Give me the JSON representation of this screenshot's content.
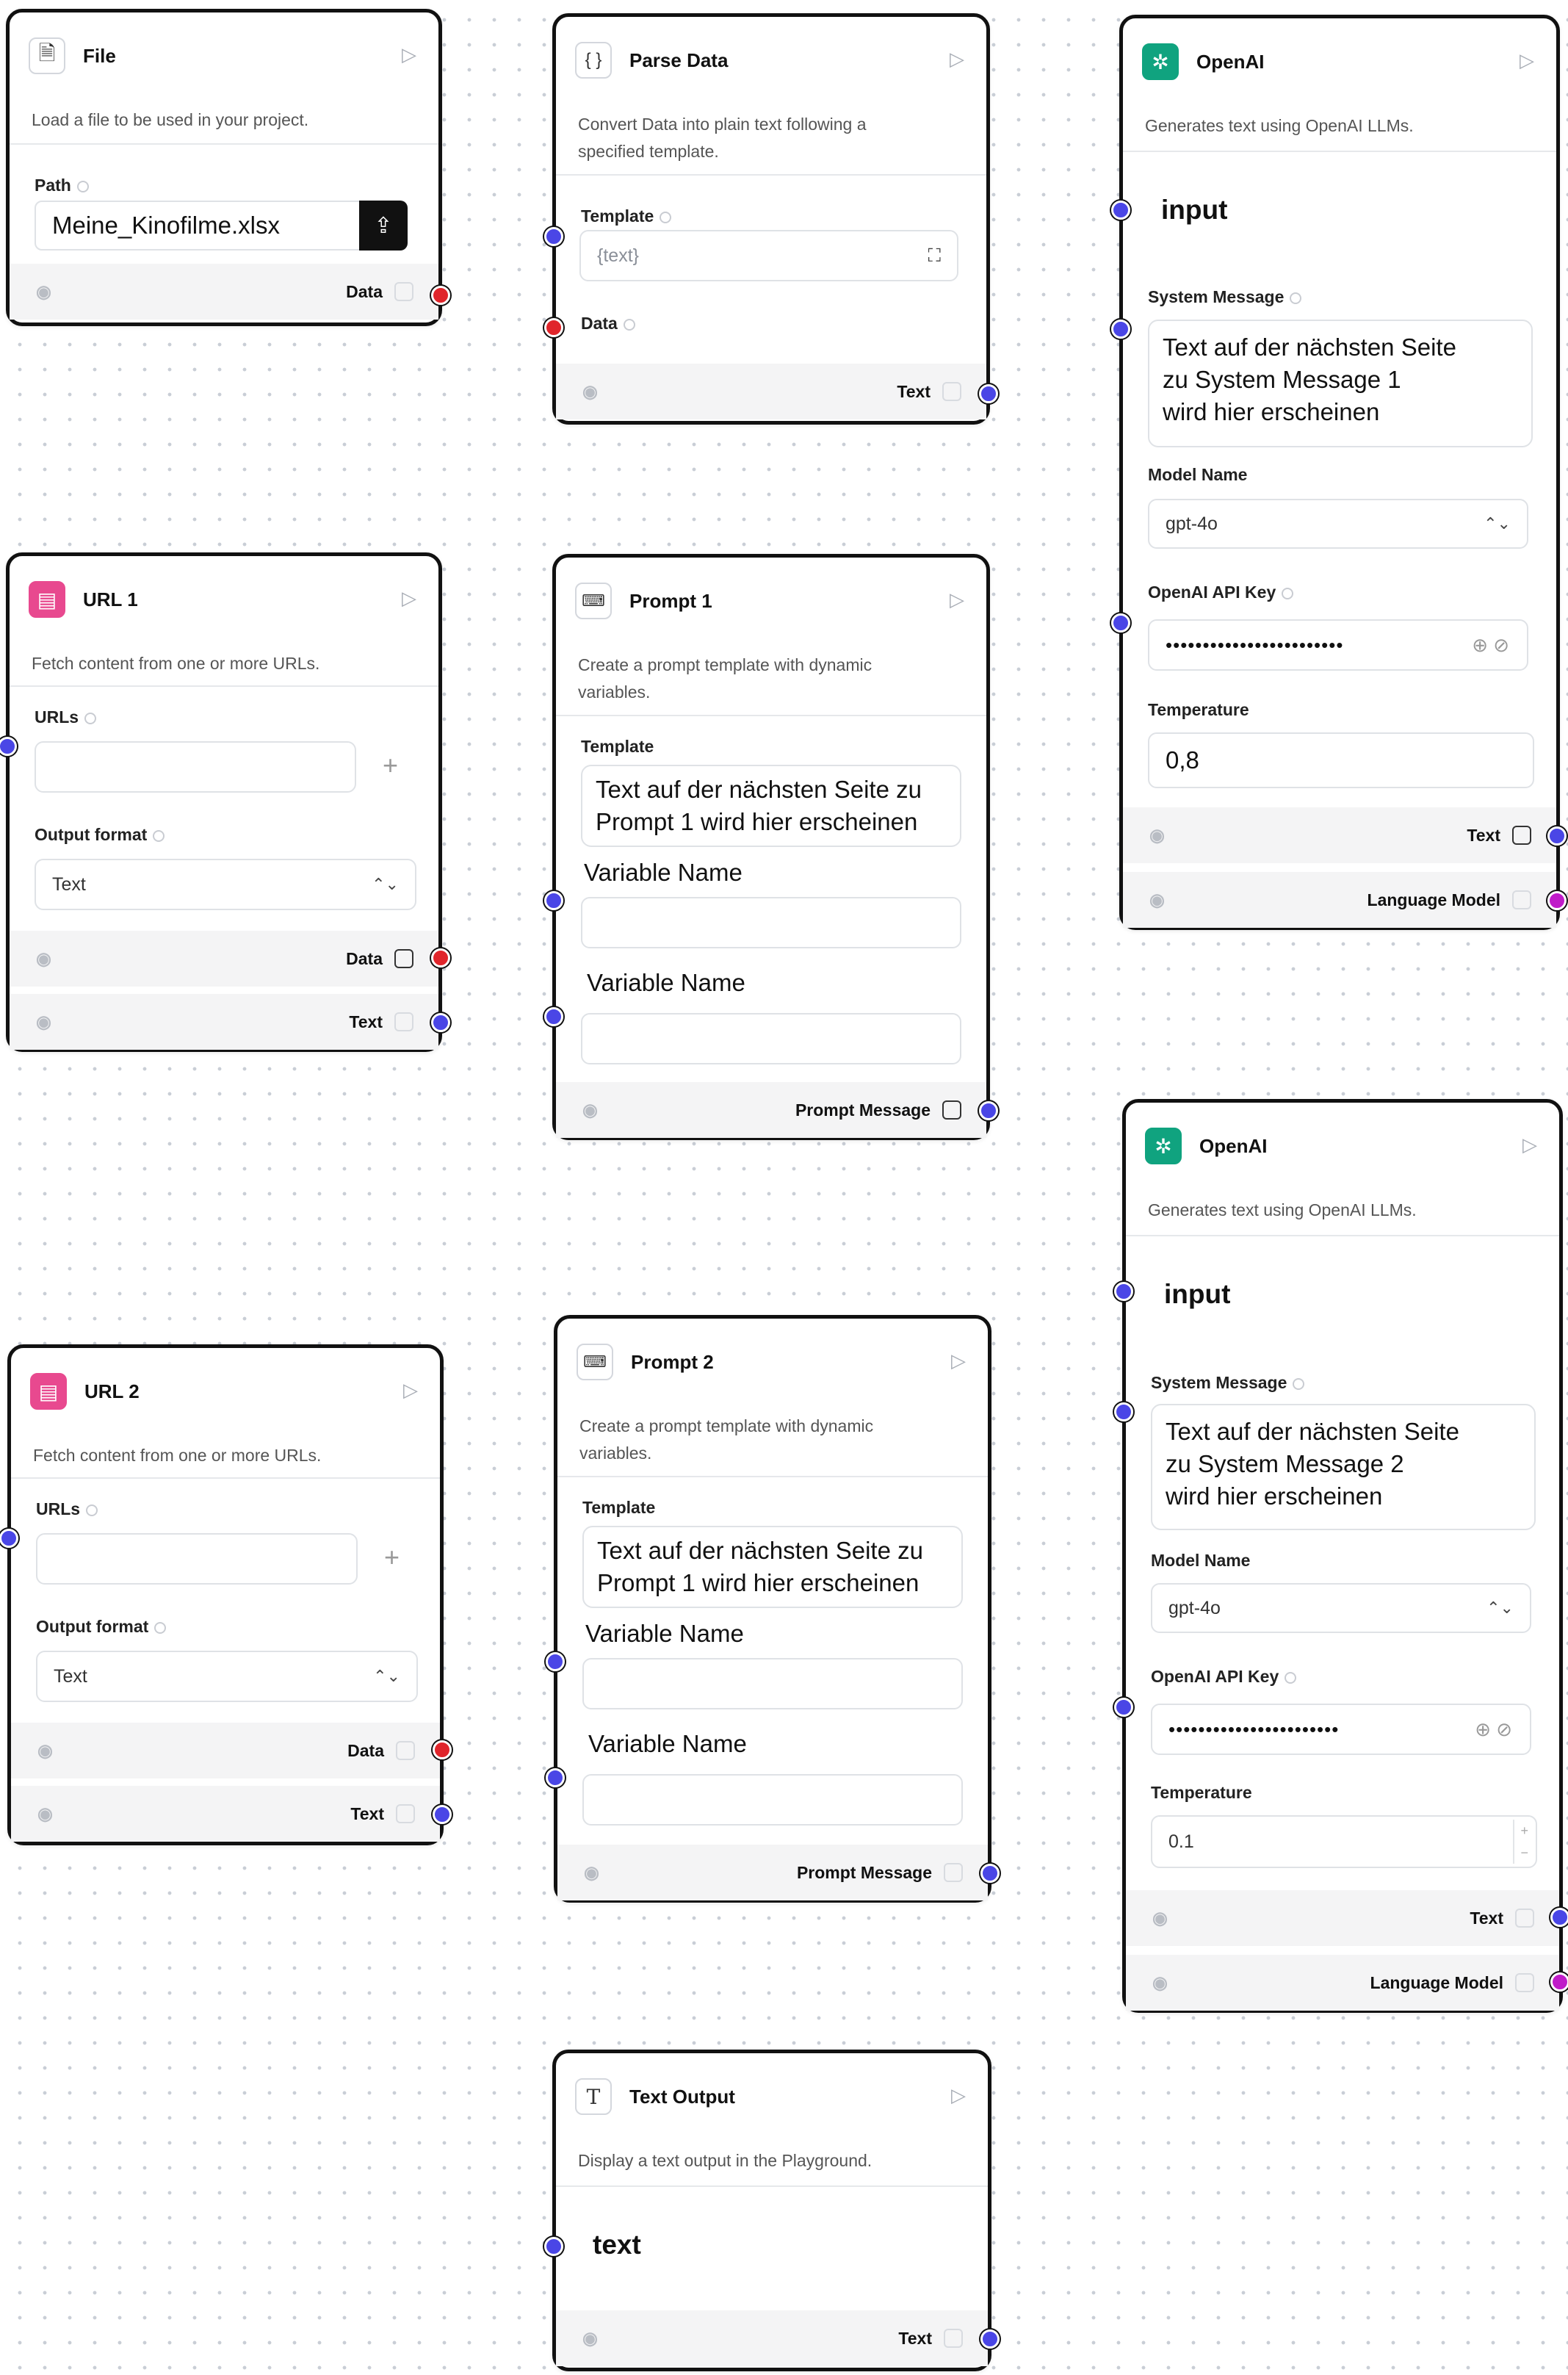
{
  "nodes": {
    "file": {
      "title": "File",
      "description": "Load a file to be used in your project.",
      "path_label": "Path",
      "path_value": "Meine_Kinofilme.xlsx",
      "output_data": "Data"
    },
    "parse": {
      "title": "Parse Data",
      "description_line1": "Convert Data into plain text following a",
      "description_line2": "specified template.",
      "template_label": "Template",
      "template_placeholder": "{text}",
      "data_label": "Data",
      "output_text": "Text"
    },
    "openai1": {
      "title": "OpenAI",
      "description": "Generates text using OpenAI LLMs.",
      "input_heading": "input",
      "system_message_label": "System Message",
      "system_message_line1": "Text auf der nächsten Seite",
      "system_message_line2": "zu System Message 1",
      "system_message_line3": "wird hier erscheinen",
      "model_label": "Model Name",
      "model_value": "gpt-4o",
      "api_key_label": "OpenAI API Key",
      "api_key_mask": "••••••••••••••••••••••••",
      "temperature_label": "Temperature",
      "temperature_value": "0,8",
      "output_text": "Text",
      "output_model": "Language Model"
    },
    "url1": {
      "title": "URL 1",
      "description": "Fetch content from one or more URLs.",
      "urls_label": "URLs",
      "format_label": "Output format",
      "format_value": "Text",
      "output_data": "Data",
      "output_text": "Text"
    },
    "prompt1": {
      "title": "Prompt 1",
      "description_line1": "Create a prompt template with dynamic",
      "description_line2": "variables.",
      "template_label": "Template",
      "template_line1": "Text auf der nächsten Seite zu",
      "template_line2": "Prompt 1 wird hier erscheinen",
      "var1_label": "Variable Name",
      "var2_label": "Variable Name",
      "output": "Prompt Message"
    },
    "openai2": {
      "title": "OpenAI",
      "description": "Generates text using OpenAI LLMs.",
      "input_heading": "input",
      "system_message_label": "System Message",
      "system_message_line1": "Text auf der nächsten Seite",
      "system_message_line2": "zu System Message 2",
      "system_message_line3": "wird hier erscheinen",
      "model_label": "Model Name",
      "model_value": "gpt-4o",
      "api_key_label": "OpenAI API Key",
      "api_key_mask": "•••••••••••••••••••••••",
      "temperature_label": "Temperature",
      "temperature_value": "0.1",
      "output_text": "Text",
      "output_model": "Language Model"
    },
    "url2": {
      "title": "URL 2",
      "description": "Fetch content from one or more URLs.",
      "urls_label": "URLs",
      "format_label": "Output format",
      "format_value": "Text",
      "output_data": "Data",
      "output_text": "Text"
    },
    "prompt2": {
      "title": "Prompt 2",
      "description_line1": "Create a prompt template with dynamic",
      "description_line2": "variables.",
      "template_label": "Template",
      "template_line1": "Text auf der nächsten Seite zu",
      "template_line2": "Prompt 1 wird hier erscheinen",
      "var1_label": "Variable Name",
      "var2_label": "Variable Name",
      "output": "Prompt Message"
    },
    "textout": {
      "title": "Text Output",
      "description": "Display a text output in the Playground.",
      "input_heading": "text",
      "output_text": "Text"
    }
  },
  "colors": {
    "handle_blue": "#4a46e6",
    "handle_red": "#e0252b",
    "handle_purple": "#c01bc9",
    "url_icon": "#e8498f",
    "openai_icon": "#10a37f"
  }
}
